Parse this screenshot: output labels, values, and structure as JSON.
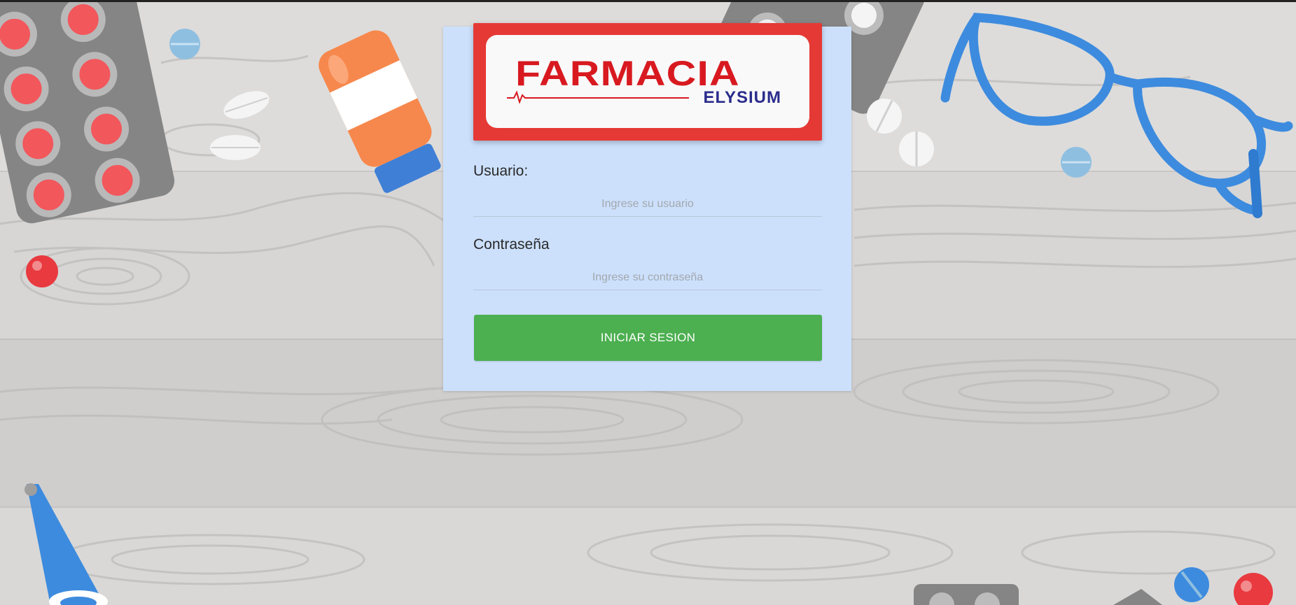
{
  "brand": {
    "name_main": "FARMACIA",
    "name_sub": "ELYSIUM"
  },
  "login": {
    "username_label": "Usuario:",
    "username_placeholder": "Ingrese su usuario",
    "username_value": "",
    "password_label": "Contraseña",
    "password_placeholder": "Ingrese su contraseña",
    "password_value": "",
    "submit_label": "INICIAR SESION"
  },
  "colors": {
    "card_background": "#cce0fc",
    "logo_frame": "#e53935",
    "logo_text_red": "#d81920",
    "logo_text_navy": "#2a2c8c",
    "button_green": "#4caf50"
  },
  "icons": {
    "logo_pulse": "heartbeat-line-icon"
  }
}
